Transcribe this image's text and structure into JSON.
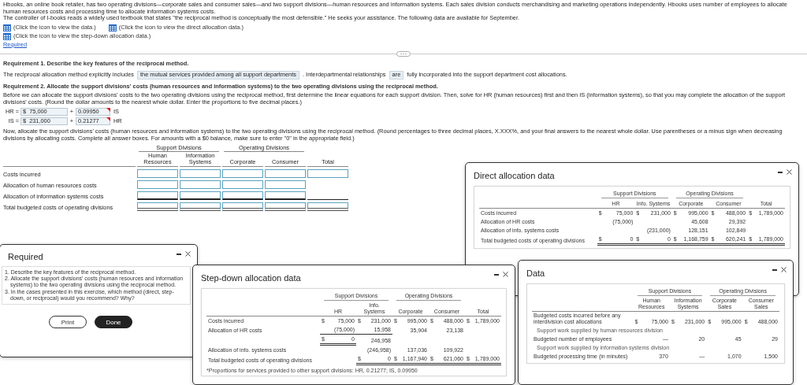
{
  "problem": {
    "intro": [
      "Hbooks, an online book retailer, has two operating divisions—corporate sales and consumer sales—and two support divisions—human resources and information systems. Each sales division conducts merchandising and marketing operations independently. Hbooks uses number of employees to allocate human resources costs and processing time to allocate information systems costs.",
      "The controller of I-books reads a widely used textbook that states \"the reciprocal method is conceptually the most defensible.\" He seeks your assistance. The following data are available for September."
    ],
    "data_links": [
      {
        "links": [
          "(Click the icon to view the data.)",
          "(Click the icon to view the direct allocation data.)"
        ]
      },
      {
        "links": [
          "(Click the icon to view the step-down allocation data.)"
        ]
      }
    ],
    "required_link": "Required",
    "requirement_1": {
      "heading": "Requirement 1. Describe the key features of the reciprocal method.",
      "sentence": [
        {
          "kind": "text",
          "text": "The reciprocal allocation method explicitly includes"
        },
        {
          "kind": "dropdown",
          "value": "the mutual services provided among all support departments"
        },
        {
          "kind": "text",
          "text": ". Interdepartmental relationships"
        },
        {
          "kind": "dropdown",
          "value": "are"
        },
        {
          "kind": "text",
          "text": "fully incorporated into the support department cost allocations."
        }
      ]
    },
    "requirement_2": {
      "heading": "Requirement 2. Allocate the support divisions' costs (human resources and information systems) to the two operating divisions using the reciprocal method.",
      "instructions": "Before we can allocate the support divisions' costs to the two operating divisions using the reciprocal method, first determine the linear equations for each support division. Then, solve for HR (human resources) first and then IS (information systems), so that you may complete the allocation of the support divisions' costs. (Round the dollar amounts to the nearest whole dollar. Enter the proportions to five decimal places.)",
      "equations": [
        {
          "lhs": "HR =",
          "currency": "$",
          "amount": "75,000",
          "operator": "+",
          "coefficient": "0.09950",
          "coefficient_flagged": true,
          "variable": "IS"
        },
        {
          "lhs": "IS =",
          "currency": "$",
          "amount": "231,000",
          "operator": "+",
          "coefficient": "0.21277",
          "coefficient_flagged": true,
          "variable": "HR"
        }
      ],
      "allocation_instructions": "Now, allocate the support divisions' costs (human resources and information systems) to the two operating divisions using the reciprocal method. (Round percentages to three decimal places, X.XXX%, and your final answers to the nearest whole dollar. Use parentheses or a minus sign when decreasing divisions by allocating costs. Complete all answer boxes. For amounts with a $0 balance, make sure to enter \"0\" in the appropriate field.)",
      "answer_table": {
        "groups": [
          {
            "label": "Support Divisions",
            "columns": [
              "Human Resources",
              "Information Systems"
            ]
          },
          {
            "label": "Operating Divisions",
            "columns": [
              "Corporate",
              "Consumer"
            ]
          }
        ],
        "extra_columns": [
          "Total"
        ],
        "rows": [
          {
            "label": "Costs incurred",
            "kind": "entry",
            "fields": [
              true,
              true,
              true,
              true,
              true
            ]
          },
          {
            "label": "Allocation of human resources costs",
            "kind": "entry",
            "fields": [
              true,
              true,
              true,
              true,
              false
            ]
          },
          {
            "label": "Allocation of information systems costs",
            "kind": "rule",
            "fields": [
              true,
              true,
              true,
              true,
              false
            ]
          },
          {
            "label": "Total budgeted costs of operating divisions",
            "kind": "total",
            "fields": [
              true,
              true,
              true,
              true,
              true
            ]
          }
        ]
      }
    }
  },
  "windows": [
    {
      "kind": "required",
      "title": "Required",
      "items": [
        "1. Describe the key features of the reciprocal method.",
        "2. Allocate the support divisions' costs (human resources and information systems) to the two operating divisions using the reciprocal method.",
        "3. In the cases presented in this exercise, which method (direct, step-down, or reciprocal) would you recommend? Why?"
      ],
      "buttons": [
        {
          "label": "Print",
          "kind": "secondary"
        },
        {
          "label": "Done",
          "kind": "primary"
        }
      ]
    },
    {
      "kind": "table",
      "title": "Direct allocation data",
      "table": {
        "groups": [
          {
            "label": "Support Divisions",
            "columns": [
              "HR",
              "Info. Systems"
            ]
          },
          {
            "label": "Operating Divisions",
            "columns": [
              "Corporate",
              "Consumer"
            ]
          }
        ],
        "extra_columns": [
          "Total"
        ],
        "rows": [
          {
            "kind": "row",
            "label": "Costs incurred",
            "cells": [
              {
                "sign": "$",
                "amount": "75,000"
              },
              {
                "sign": "$",
                "amount": "231,000"
              },
              {
                "sign": "$",
                "amount": "995,000"
              },
              {
                "sign": "$",
                "amount": "488,000"
              },
              {
                "sign": "$",
                "amount": "1,789,000"
              }
            ]
          },
          {
            "kind": "row",
            "label": "Allocation of HR costs",
            "cells": [
              {
                "amount": "(75,000)"
              },
              null,
              {
                "amount": "45,608"
              },
              {
                "amount": "29,392"
              },
              null
            ]
          },
          {
            "kind": "row",
            "label": "Allocation of info. systems costs",
            "cells": [
              null,
              {
                "amount": "(231,000)"
              },
              {
                "amount": "128,151"
              },
              {
                "amount": "102,849"
              },
              null
            ]
          },
          {
            "kind": "row",
            "label": "Total budgeted costs of operating divisions",
            "cells": [
              {
                "sign": "$",
                "amount": "0",
                "double_rule": true
              },
              {
                "sign": "$",
                "amount": "0",
                "double_rule": true
              },
              {
                "sign": "$",
                "amount": "1,168,759",
                "double_rule": true
              },
              {
                "sign": "$",
                "amount": "620,241",
                "double_rule": true
              },
              {
                "sign": "$",
                "amount": "1,789,000",
                "double_rule": true
              }
            ]
          }
        ]
      }
    },
    {
      "kind": "table",
      "title": "Step-down allocation data",
      "table": {
        "groups": [
          {
            "label": "Support Divisions",
            "columns": [
              "HR",
              "Info. Systems"
            ]
          },
          {
            "label": "Operating Divisions",
            "columns": [
              "Corporate",
              "Consumer"
            ]
          }
        ],
        "extra_columns": [
          "Total"
        ],
        "rows": [
          {
            "kind": "row",
            "label": "Costs incurred",
            "cells": [
              {
                "sign": "$",
                "amount": "75,000"
              },
              {
                "sign": "$",
                "amount": "231,000"
              },
              {
                "sign": "$",
                "amount": "995,000"
              },
              {
                "sign": "$",
                "amount": "488,000"
              },
              {
                "sign": "$",
                "amount": "1,789,000"
              }
            ]
          },
          {
            "kind": "row",
            "label": "Allocation of HR costs",
            "cells": [
              {
                "amount": "(75,000)",
                "rule": true
              },
              {
                "amount": "15,958",
                "rule": true
              },
              {
                "amount": "35,904"
              },
              {
                "amount": "23,138"
              },
              null
            ]
          },
          {
            "kind": "row",
            "cells": [
              {
                "sign": "$",
                "amount": "0",
                "double_rule": true
              },
              {
                "amount": "246,958"
              },
              null,
              null,
              null
            ]
          },
          {
            "kind": "row",
            "label": "Allocation of info. systems costs",
            "cells": [
              null,
              {
                "amount": "(246,958)"
              },
              {
                "amount": "137,036"
              },
              {
                "amount": "109,922"
              },
              null
            ]
          },
          {
            "kind": "row",
            "label": "Total budgeted costs of operating divisions",
            "cells": [
              null,
              {
                "sign": "$",
                "amount": "0",
                "double_rule": true
              },
              {
                "sign": "$",
                "amount": "1,167,940",
                "double_rule": true
              },
              {
                "sign": "$",
                "amount": "621,060",
                "double_rule": true
              },
              {
                "sign": "$",
                "amount": "1,789,000",
                "double_rule": true
              }
            ]
          }
        ],
        "footnote": "*Proportions for services provided to other support divisions: HR, 0.21277; IS, 0.09950"
      }
    },
    {
      "kind": "table",
      "title": "Data",
      "table": {
        "groups": [
          {
            "label": "Support Divisions",
            "columns": [
              "Human Resources",
              "Information Systems"
            ]
          },
          {
            "label": "Operating Divisions",
            "columns": [
              "Corporate Sales",
              "Consumer Sales"
            ]
          }
        ],
        "rows": [
          {
            "kind": "row",
            "label": "Budgeted costs incurred before any interdivision cost allocations",
            "cells": [
              {
                "sign": "$",
                "amount": "75,000"
              },
              {
                "sign": "$",
                "amount": "231,000"
              },
              {
                "sign": "$",
                "amount": "995,000"
              },
              {
                "sign": "$",
                "amount": "488,000"
              }
            ]
          },
          {
            "kind": "subheading",
            "label": "Support work supplied by human resources division"
          },
          {
            "kind": "row",
            "label": "Budgeted number of employees",
            "cells": [
              {
                "amount": "—"
              },
              {
                "amount": "20"
              },
              {
                "amount": "45"
              },
              {
                "amount": "29"
              }
            ]
          },
          {
            "kind": "subheading",
            "label": "Support work supplied by information systems division"
          },
          {
            "kind": "row",
            "label": "Budgeted processing time (in minutes)",
            "cells": [
              {
                "amount": "370"
              },
              {
                "amount": "—"
              },
              {
                "amount": "1,070"
              },
              {
                "amount": "1,500"
              }
            ]
          }
        ]
      }
    }
  ]
}
